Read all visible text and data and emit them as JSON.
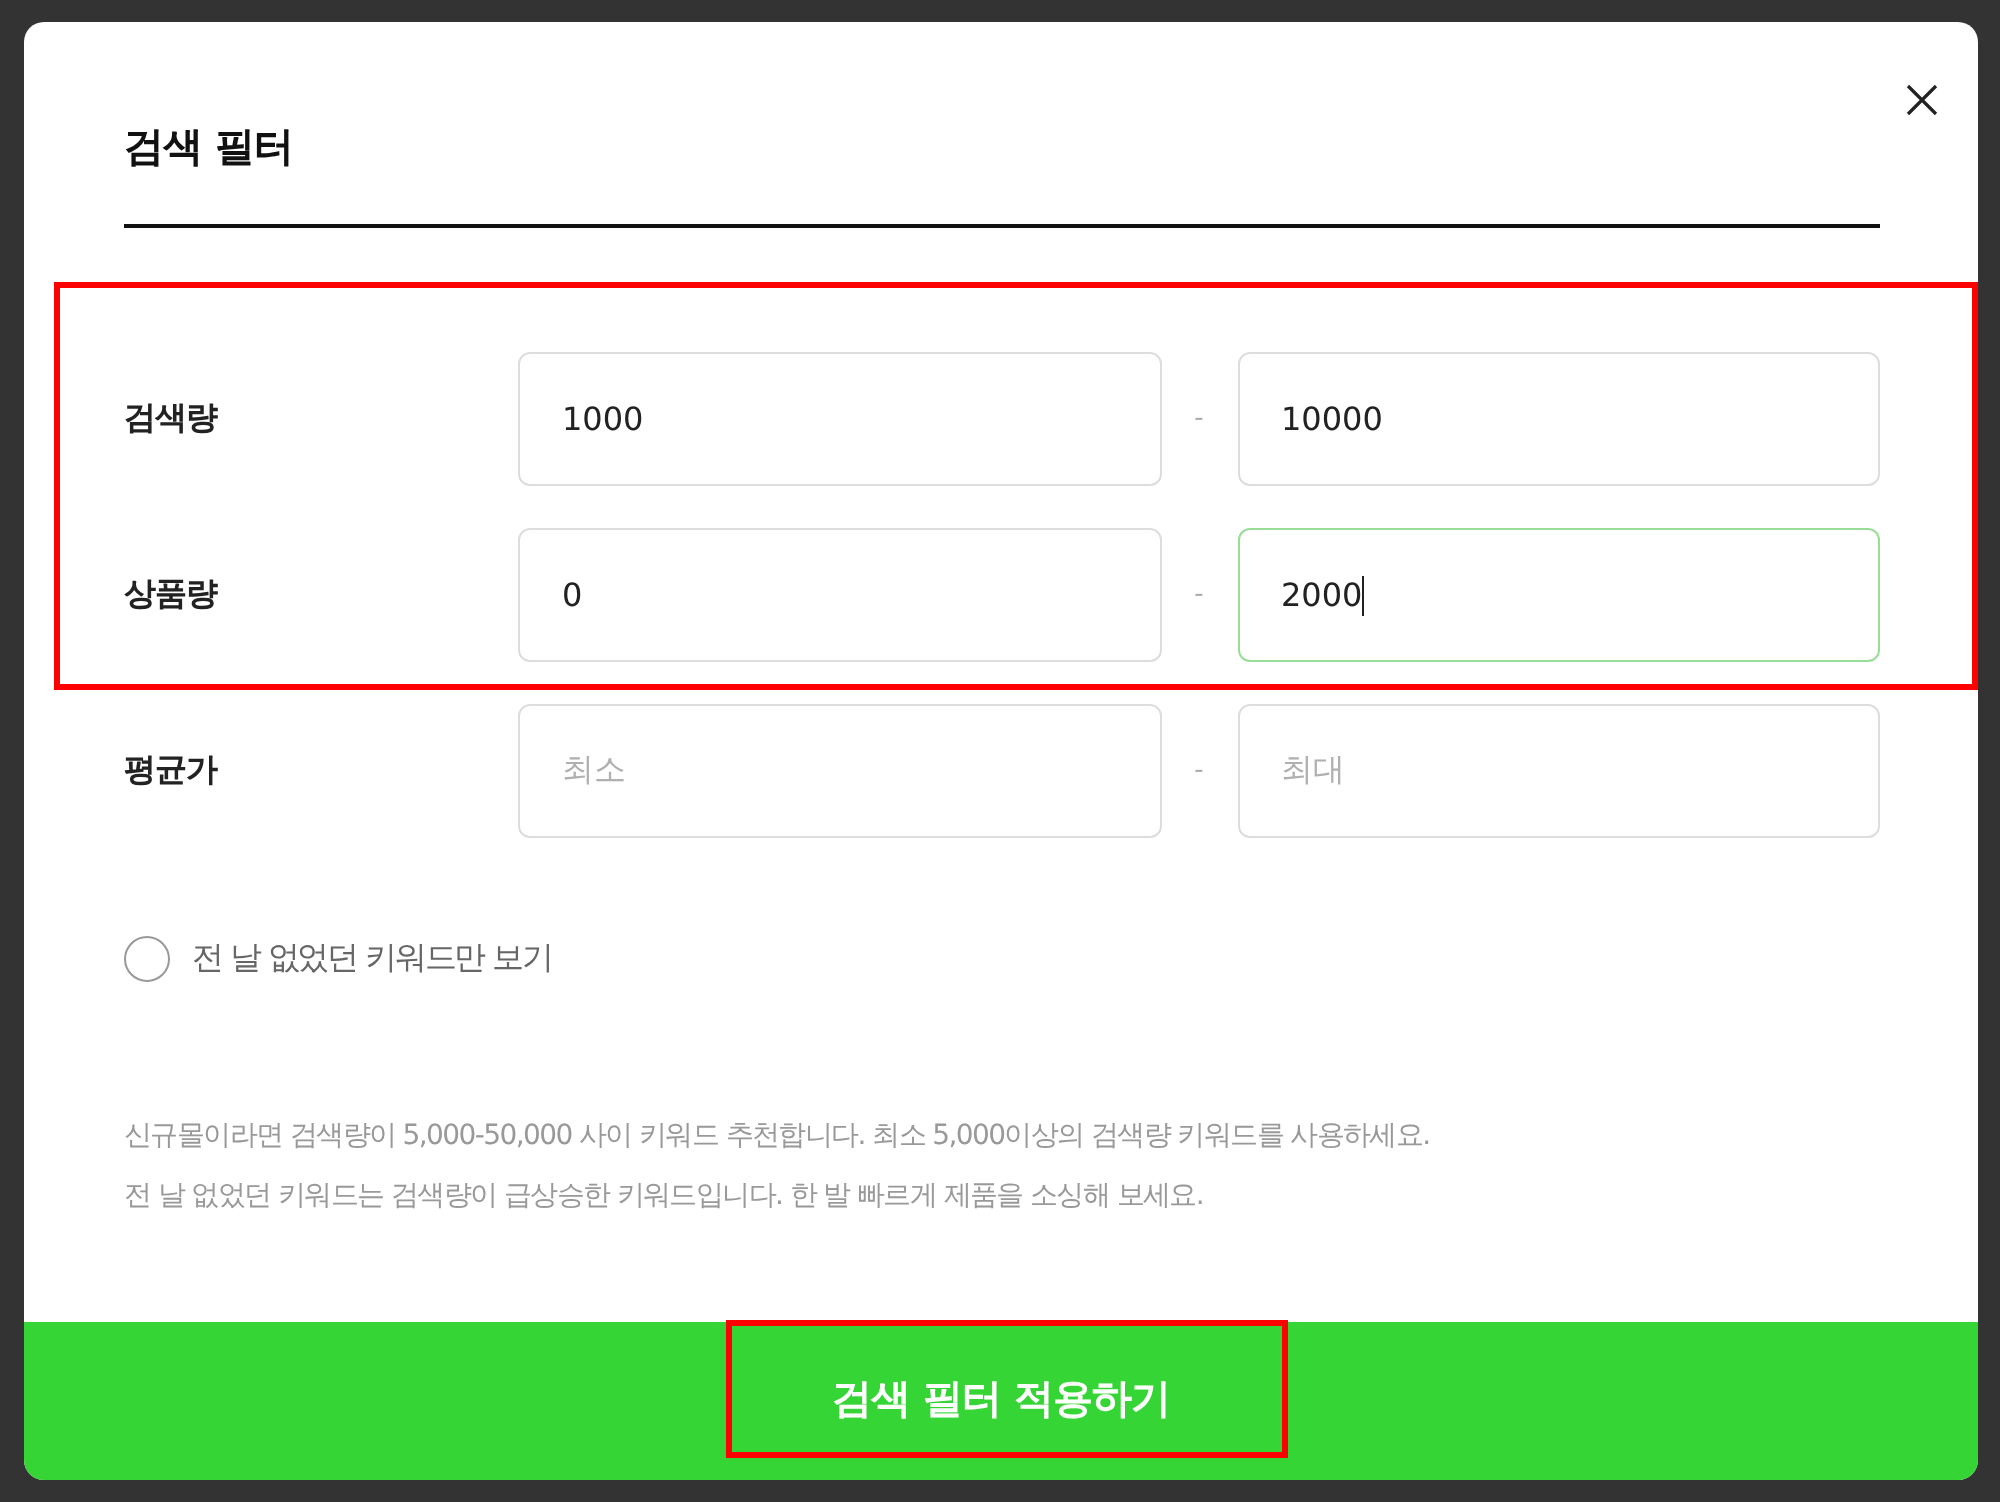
{
  "dialog": {
    "title": "검색 필터"
  },
  "filters": [
    {
      "label": "검색량",
      "highlighted": true,
      "separator": "-",
      "min": {
        "value": "1000",
        "focused": false
      },
      "max": {
        "value": "10000",
        "focused": false
      }
    },
    {
      "label": "상품량",
      "highlighted": true,
      "separator": "-",
      "min": {
        "value": "0",
        "focused": false
      },
      "max": {
        "value": "2000",
        "focused": true
      }
    },
    {
      "label": "평균가",
      "highlighted": false,
      "separator": "-",
      "min": {
        "placeholder": "최소",
        "focused": false
      },
      "max": {
        "placeholder": "최대",
        "focused": false
      }
    }
  ],
  "option": {
    "label": "전 날 없었던 키워드만 보기",
    "checked": false
  },
  "notes": [
    "신규몰이라면 검색량이 5,000-50,000 사이 키워드 추천합니다. 최소 5,000이상의 검색량 키워드를 사용하세요.",
    "전 날 없었던 키워드는 검색량이 급상승한 키워드입니다. 한 발 빠르게 제품을 소싱해 보세요."
  ],
  "apply_button": {
    "label": "검색 필터 적용하기",
    "highlighted": true
  }
}
